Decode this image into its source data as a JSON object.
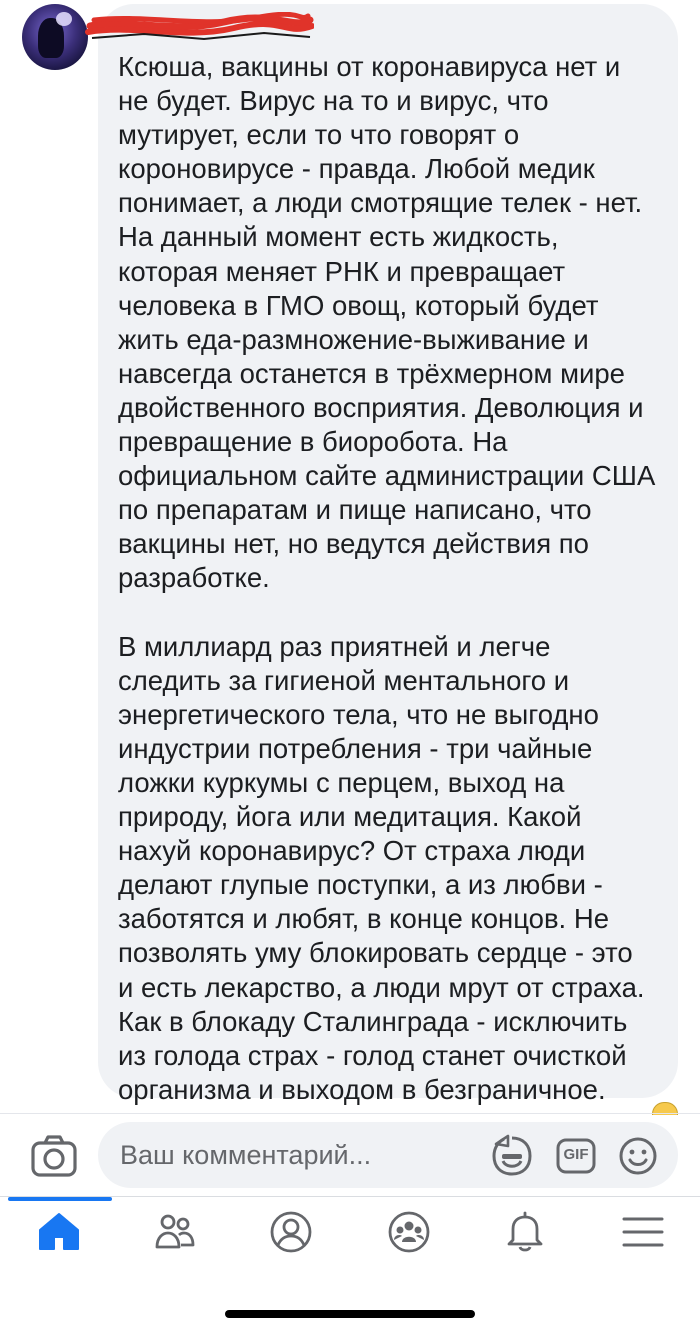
{
  "comment": {
    "author_redacted": true,
    "paragraphs": [
      "Ксюша, вакцины от коронавируса нет и\nне будет. Вирус на то и вирус, что\nмутирует, если то что говорят о\nкороновирусе - правда. Любой медик\nпонимает, а люди смотрящие телек - нет.\nНа данный момент есть жидкость,\nкоторая меняет РНК и превращает\nчеловека в ГМО овощ, который будет\nжить еда-размножение-выживание и\nнавсегда останется в трёхмерном мире\nдвойственного восприятия. Деволюция и\nпревращение в биоробота. На\nофициальном сайте администрации США\nпо препаратам и пище написано, что\nвакцины нет, но ведутся действия по\nразработке.",
      "В миллиард раз приятней и легче\nследить за гигиеной ментального и\nэнергетического тела, что не выгодно\nиндустрии потребления - три чайные\nложки куркумы с перцем, выход на\nприроду, йога или медитация. Какой\nнахуй коронавирус? От страха люди\nделают глупые поступки, а из любви -\nзаботятся и любят, в конце концов. Не\nпозволять уму блокировать сердце - это\nи есть лекарство, а люди мрут от страха.\nКак в блокаду Сталинграда - исключить\nиз голода страх - голод станет очисткой\nорганизма и выходом в безграничное."
    ]
  },
  "composer": {
    "placeholder": "Ваш комментарий...",
    "gif_label": "GIF",
    "icons": [
      "camera-icon",
      "sticker-icon",
      "gif-icon",
      "emoji-icon"
    ]
  },
  "tabbar": {
    "items": [
      {
        "icon": "home-icon",
        "active": true
      },
      {
        "icon": "friends-icon",
        "active": false
      },
      {
        "icon": "profile-icon",
        "active": false
      },
      {
        "icon": "groups-icon",
        "active": false
      },
      {
        "icon": "bell-icon",
        "active": false
      },
      {
        "icon": "menu-icon",
        "active": false
      }
    ]
  },
  "colors": {
    "accent": "#1877f2",
    "icon_gray": "#65676b",
    "bubble": "#f0f2f5",
    "text": "#1c1e21",
    "redaction": "#e0332a"
  }
}
